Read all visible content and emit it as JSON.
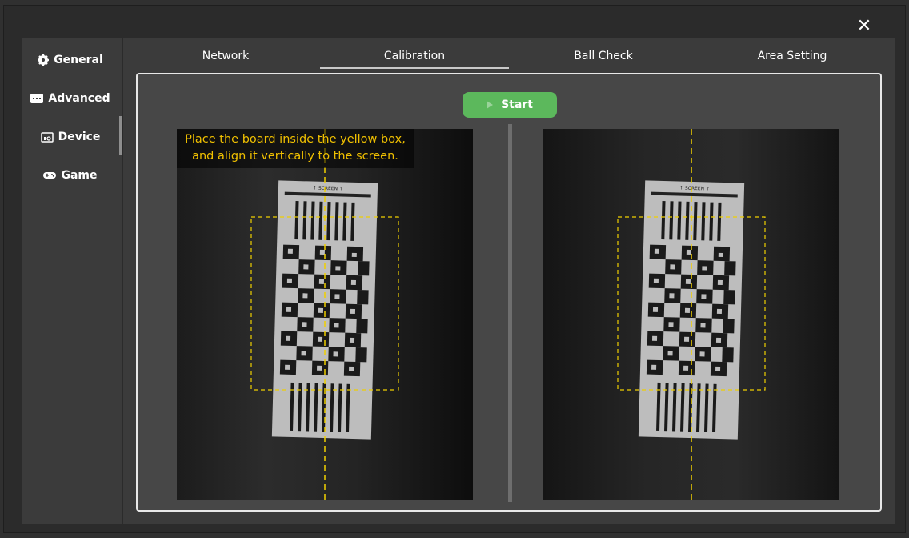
{
  "window": {
    "close_icon": "close-icon"
  },
  "sidebar": {
    "items": [
      {
        "label": "General",
        "icon": "gear-icon"
      },
      {
        "label": "Advanced",
        "icon": "keyboard-icon"
      },
      {
        "label": "Device",
        "icon": "device-icon",
        "active": true
      },
      {
        "label": "Game",
        "icon": "gamepad-icon"
      }
    ]
  },
  "tabs": [
    {
      "label": "Network"
    },
    {
      "label": "Calibration",
      "active": true
    },
    {
      "label": "Ball Check"
    },
    {
      "label": "Area Setting"
    }
  ],
  "calibration": {
    "start_label": "Start",
    "instruction_line1": "Place the board inside the yellow box,",
    "instruction_line2": "and align it vertically to the screen.",
    "board_label": "↑ SCREEN ↑"
  },
  "colors": {
    "accent_green": "#5cb85c",
    "guide_yellow": "#f0d000",
    "instruction_text": "#f0c000"
  }
}
